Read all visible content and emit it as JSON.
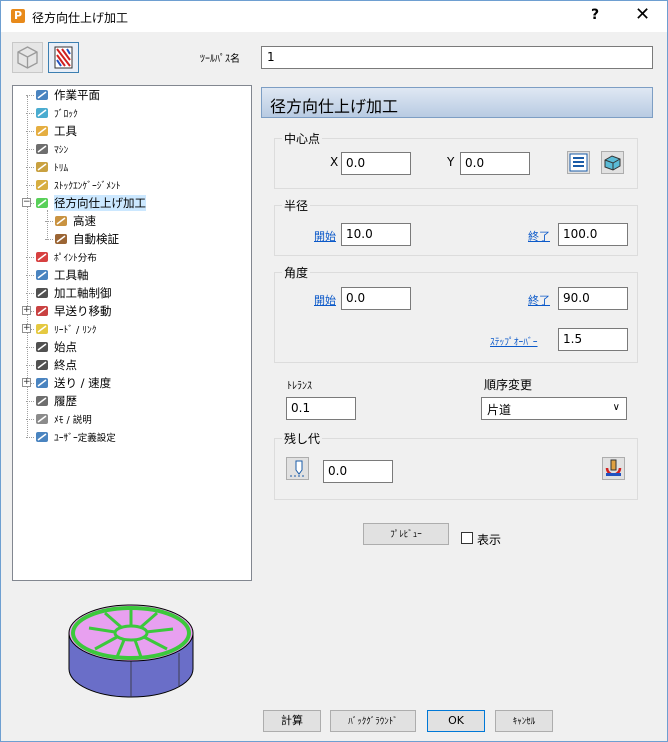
{
  "window": {
    "title": "径方向仕上げ加工",
    "help_label": "?",
    "close_label": "✕",
    "app_icon_label": "P"
  },
  "toolpath_name": {
    "label": "ﾂｰﾙﾊﾟｽ名",
    "value": "1"
  },
  "tree": {
    "items": [
      {
        "label": "作業平面",
        "icon": "workplane-icon",
        "small": false
      },
      {
        "label": "ﾌﾞﾛｯｸ",
        "icon": "block-icon",
        "small": true
      },
      {
        "label": "工具",
        "icon": "tool-icon",
        "small": false
      },
      {
        "label": "ﾏｼﾝ",
        "icon": "machine-icon",
        "small": true
      },
      {
        "label": "ﾄﾘﾑ",
        "icon": "trim-icon",
        "small": true
      },
      {
        "label": "ｽﾄｯｸｴﾝｹﾞｰｼﾞﾒﾝﾄ",
        "icon": "stock-engagement-icon",
        "small": true
      },
      {
        "label": "径方向仕上げ加工",
        "icon": "radial-finishing-icon",
        "small": false
      },
      {
        "label": "高速",
        "icon": "high-speed-icon",
        "small": false
      },
      {
        "label": "自動検証",
        "icon": "auto-verify-icon",
        "small": false
      },
      {
        "label": "ﾎﾟｲﾝﾄ分布",
        "icon": "point-distribution-icon",
        "small": true
      },
      {
        "label": "工具軸",
        "icon": "tool-axis-icon",
        "small": false
      },
      {
        "label": "加工軸制御",
        "icon": "axis-control-icon",
        "small": false
      },
      {
        "label": "早送り移動",
        "icon": "rapid-move-icon",
        "small": false
      },
      {
        "label": "ﾘｰﾄﾞ / ﾘﾝｸ",
        "icon": "lead-link-icon",
        "small": true
      },
      {
        "label": "始点",
        "icon": "start-point-icon",
        "small": false
      },
      {
        "label": "終点",
        "icon": "end-point-icon",
        "small": false
      },
      {
        "label": "送り / 速度",
        "icon": "feed-speed-icon",
        "small": false
      },
      {
        "label": "履歴",
        "icon": "history-icon",
        "small": false
      },
      {
        "label": "ﾒﾓ / 説明",
        "icon": "memo-icon",
        "small": true
      },
      {
        "label": "ﾕｰｻﾞｰ定義設定",
        "icon": "user-defined-icon",
        "small": true
      }
    ]
  },
  "panel": {
    "title": "径方向仕上げ加工",
    "center": {
      "title": "中心点",
      "x_label": "X",
      "x_value": "0.0",
      "y_label": "Y",
      "y_value": "0.0"
    },
    "radius": {
      "title": "半径",
      "start_label": "開始",
      "start_value": "10.0",
      "end_label": "終了",
      "end_value": "100.0"
    },
    "angle": {
      "title": "角度",
      "start_label": "開始",
      "start_value": "0.0",
      "end_label": "終了",
      "end_value": "90.0",
      "stepover_label": "ｽﾃｯﾌﾟｵｰﾊﾞｰ",
      "stepover_value": "1.5"
    },
    "tolerance": {
      "label": "ﾄﾚﾗﾝｽ",
      "value": "0.1"
    },
    "order": {
      "label": "順序変更",
      "value": "片道"
    },
    "stock": {
      "title": "残し代",
      "value": "0.0"
    },
    "preview_label": "ﾌﾟﾚﾋﾞｭｰ",
    "display_label": "表示"
  },
  "buttons": {
    "calc": "計算",
    "background": "ﾊﾞｯｸｸﾞﾗｳﾝﾄﾞ",
    "ok": "OK",
    "cancel": "ｷｬﾝｾﾙ"
  },
  "colors": {
    "accent": "#0b59c9",
    "header_top": "#dfe8f3",
    "header_bottom": "#b8cbe2",
    "preview_top": "#e8a0f0",
    "preview_side": "#6a6ec8",
    "preview_stripe": "#3cc83c"
  }
}
